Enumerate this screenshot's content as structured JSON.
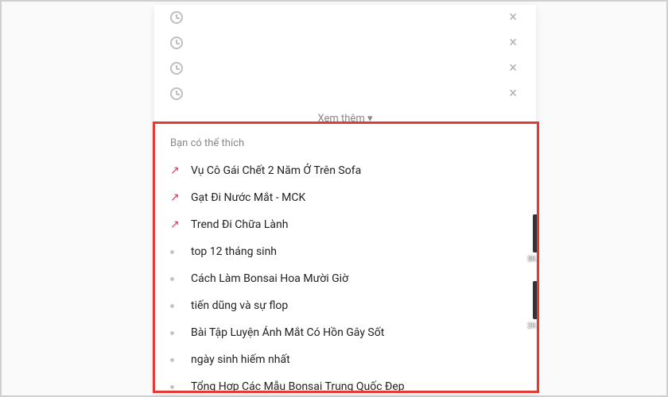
{
  "history": {
    "items": [
      {
        "text": ""
      },
      {
        "text": ""
      },
      {
        "text": ""
      },
      {
        "text": ""
      }
    ],
    "see_more": "Xem thêm ▾"
  },
  "suggestions": {
    "heading": "Bạn có thể thích",
    "items": [
      {
        "type": "trend",
        "label": "Vụ Cô Gái Chết 2 Năm Ở Trên Sofa"
      },
      {
        "type": "trend",
        "label": "Gạt Đi Nước Mắt - MCK"
      },
      {
        "type": "trend",
        "label": "Trend Đi Chữa Lành"
      },
      {
        "type": "dot",
        "label": "top 12 tháng sinh"
      },
      {
        "type": "dot",
        "label": "Cách Làm Bonsai Hoa Mười Giờ"
      },
      {
        "type": "dot",
        "label": "tiến dũng và sự flop"
      },
      {
        "type": "dot",
        "label": "Bài Tập Luyện Ánh Mắt Có Hồn Gây Sốt"
      },
      {
        "type": "dot",
        "label": "ngày sinh hiếm nhất"
      },
      {
        "type": "dot",
        "label": "Tổng Hợp Các Mẫu Bonsai Trung Quốc Đẹp"
      }
    ]
  },
  "side": [
    {
      "badge": "5K"
    },
    {
      "badge": "2K"
    }
  ]
}
